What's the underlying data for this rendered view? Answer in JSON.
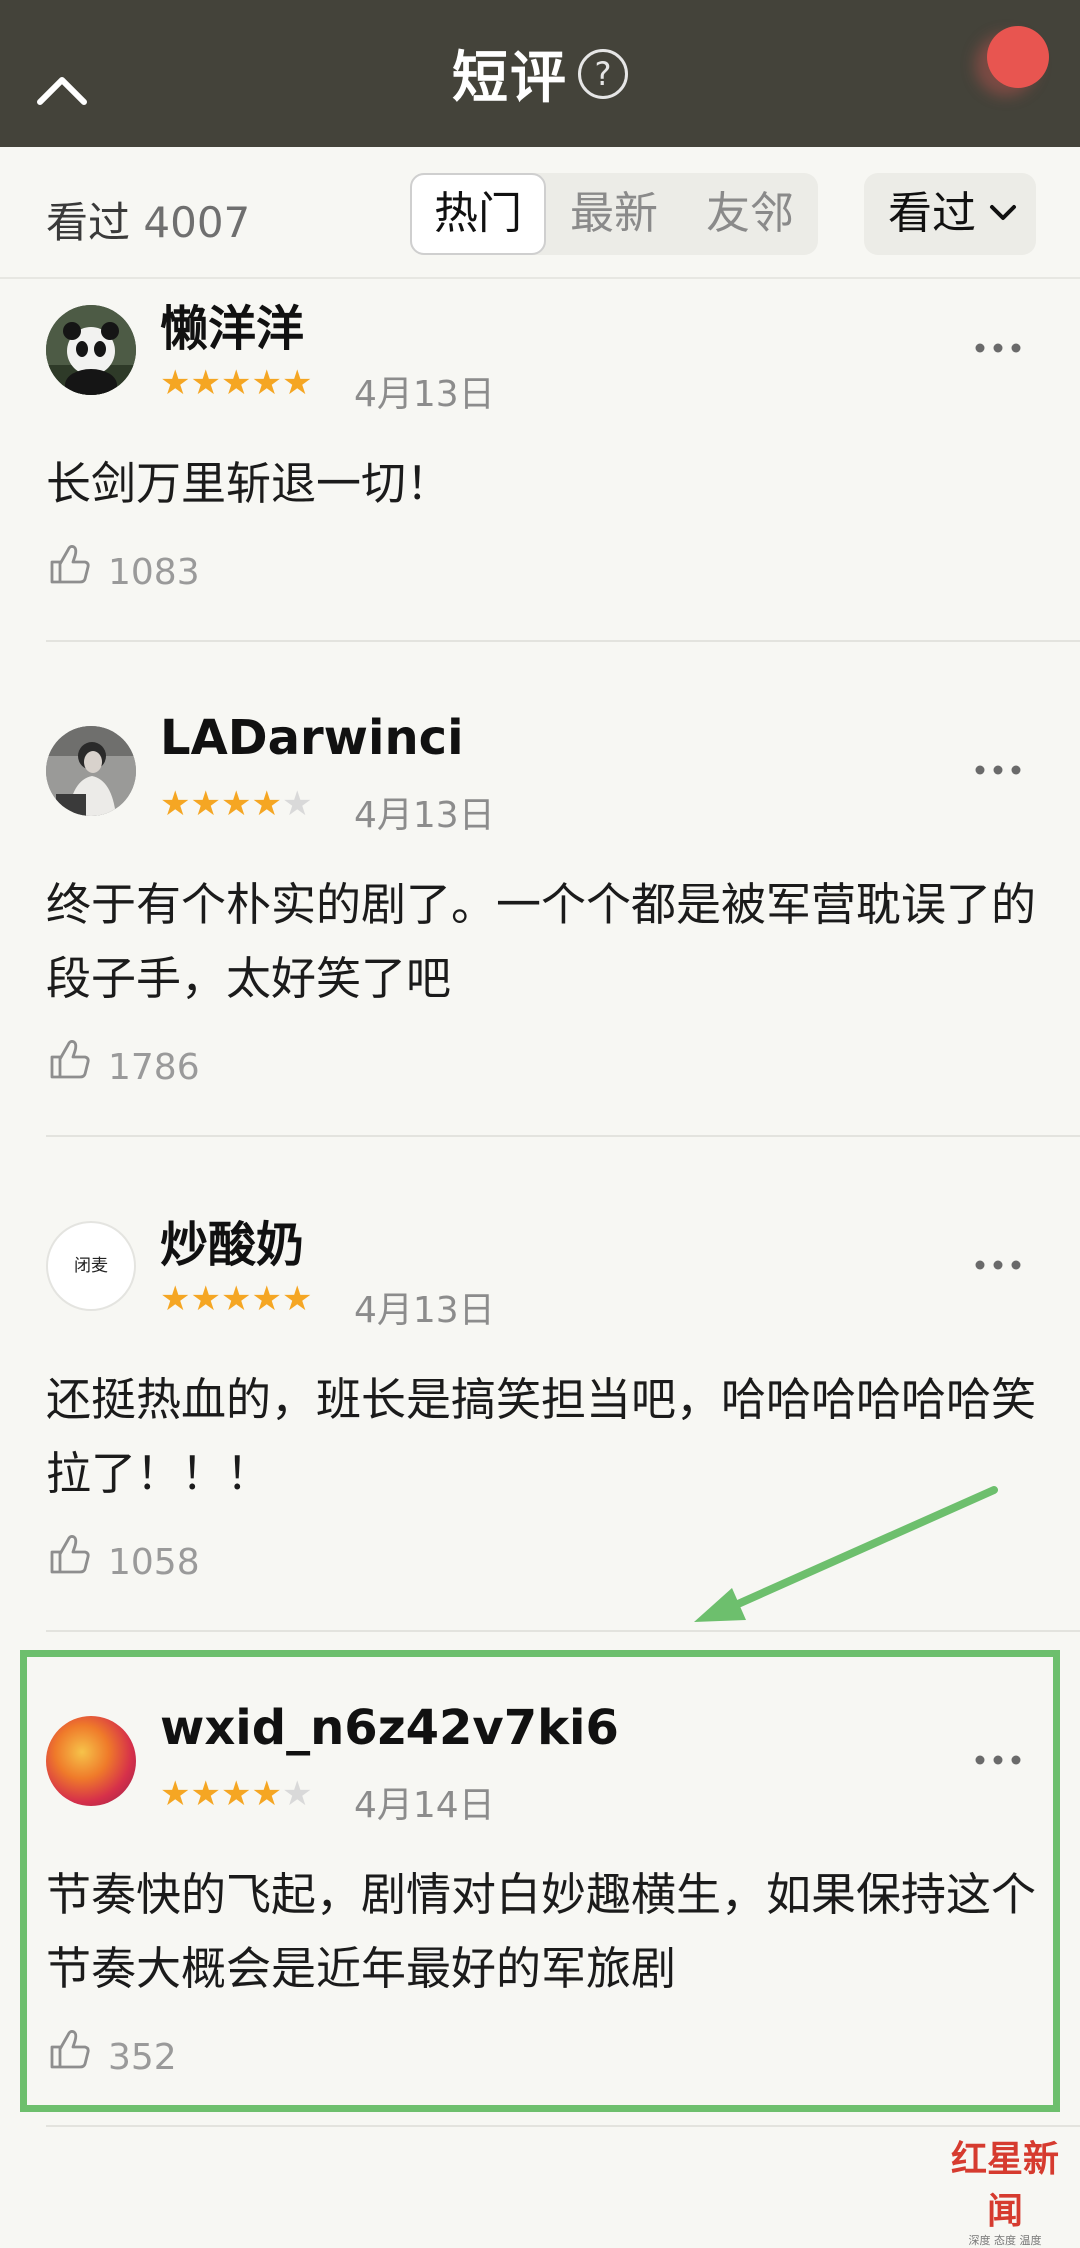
{
  "header": {
    "title": "短评",
    "help_glyph": "?"
  },
  "filter": {
    "seen_label": "看过",
    "seen_count": "4007",
    "tabs": [
      {
        "label": "热门",
        "active": true
      },
      {
        "label": "最新",
        "active": false
      },
      {
        "label": "友邻",
        "active": false
      }
    ],
    "dropdown_label": "看过"
  },
  "comments": [
    {
      "username": "懒洋洋",
      "rating": 5,
      "date": "4月13日",
      "text": "长剑万里斩退一切！",
      "likes": "1083"
    },
    {
      "username": "LADarwinci",
      "rating": 4,
      "date": "4月13日",
      "text": "终于有个朴实的剧了。一个个都是被军营耽误了的段子手，太好笑了吧",
      "likes": "1786"
    },
    {
      "username": "炒酸奶",
      "avatar_text": "闭麦",
      "rating": 5,
      "date": "4月13日",
      "text": "还挺热血的，班长是搞笑担当吧，哈哈哈哈哈哈笑拉了！！！",
      "likes": "1058"
    },
    {
      "username": "wxid_n6z42v7ki6",
      "rating": 4,
      "date": "4月14日",
      "text": "节奏快的飞起，剧情对白妙趣横生，如果保持这个节奏大概会是近年最好的军旅剧",
      "likes": "352"
    }
  ],
  "watermark": {
    "main": "红星新闻",
    "sub": "深度 态度 温度"
  },
  "colors": {
    "header_bg": "#44433a",
    "star": "#f5a623",
    "highlight": "#6dbf6d",
    "record_dot": "#e85550"
  }
}
